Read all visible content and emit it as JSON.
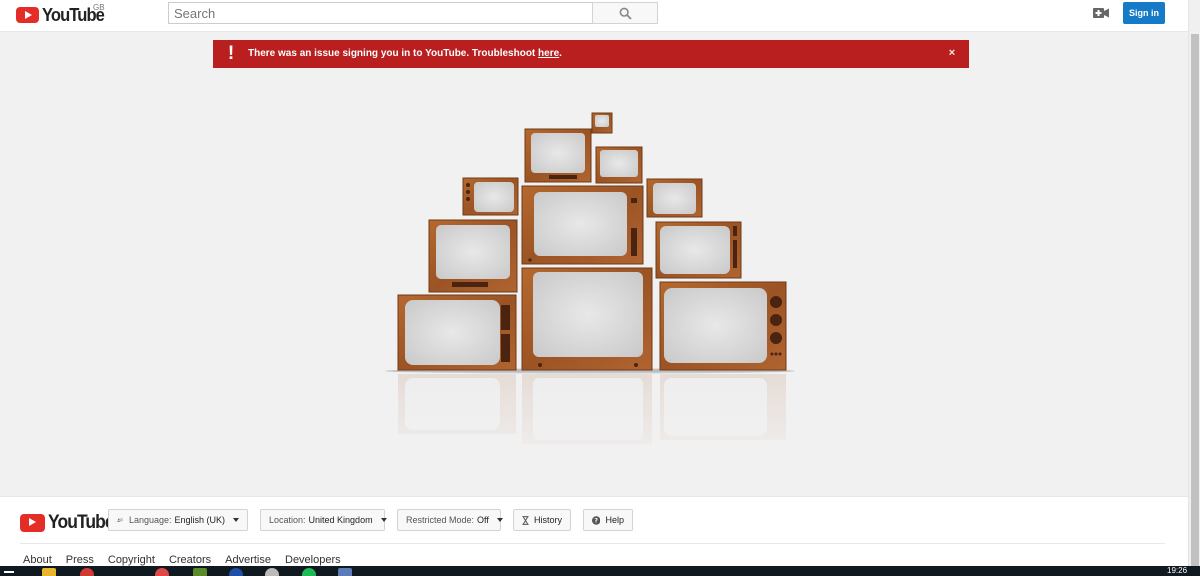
{
  "header": {
    "logo_text": "YouTube",
    "region": "GB",
    "search_placeholder": "Search",
    "signin_label": "Sign in",
    "icons": [
      "search-icon",
      "upload-video-icon"
    ]
  },
  "alert": {
    "icon": "!",
    "message_before": "There was an issue signing you in to YouTube. Troubleshoot ",
    "link_text": "here",
    "message_after": ".",
    "close": "×",
    "color": "#b91f1f"
  },
  "footer": {
    "logo_text": "YouTube",
    "language_label": "Language:",
    "language_value": "English (UK)",
    "location_label": "Location:",
    "location_value": "United Kingdom",
    "restricted_label": "Restricted Mode:",
    "restricted_value": "Off",
    "history_label": "History",
    "help_label": "Help",
    "links": [
      "About",
      "Press",
      "Copyright",
      "Creators",
      "Advertise",
      "Developers"
    ]
  },
  "taskbar": {
    "time": "19:26"
  },
  "colors": {
    "brand_red": "#e52d27",
    "accent_blue": "#167ac6",
    "tv_wood": "#a0582a"
  }
}
